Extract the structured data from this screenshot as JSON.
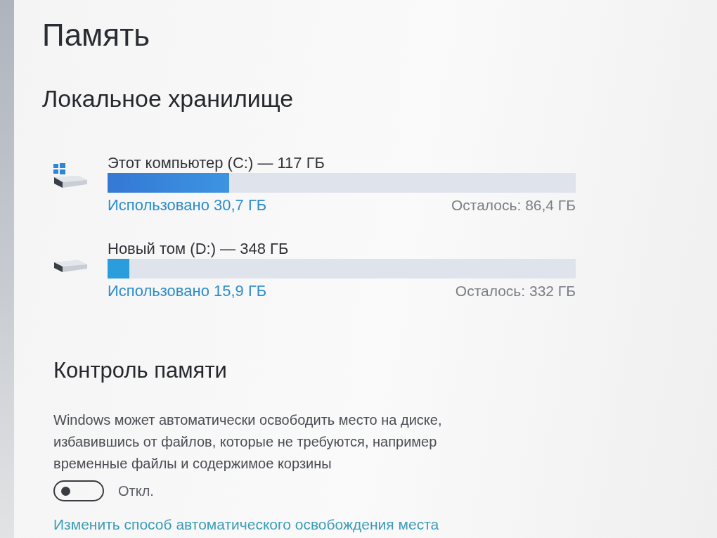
{
  "page": {
    "title": "Память"
  },
  "local_storage": {
    "heading": "Локальное хранилище",
    "drives": [
      {
        "kind": "system",
        "name": "Этот компьютер (C:) — 117 ГБ",
        "level": 0.26,
        "used": "Использовано 30,7 ГБ",
        "free": "Осталось: 86,4 ГБ"
      },
      {
        "kind": "data",
        "name": "Новый том (D:) — 348 ГБ",
        "level": 0.046,
        "used": "Использовано 15,9 ГБ",
        "free": "Осталось: 332 ГБ"
      }
    ]
  },
  "storage_sense": {
    "heading": "Контроль памяти",
    "description": "Windows может автоматически освободить место на диске, избавившись от файлов, которые не требуются, например временные файлы и содержимое корзины",
    "toggle": {
      "on": false,
      "label": "Откл."
    },
    "link": "Изменить способ автоматического освобождения места"
  }
}
